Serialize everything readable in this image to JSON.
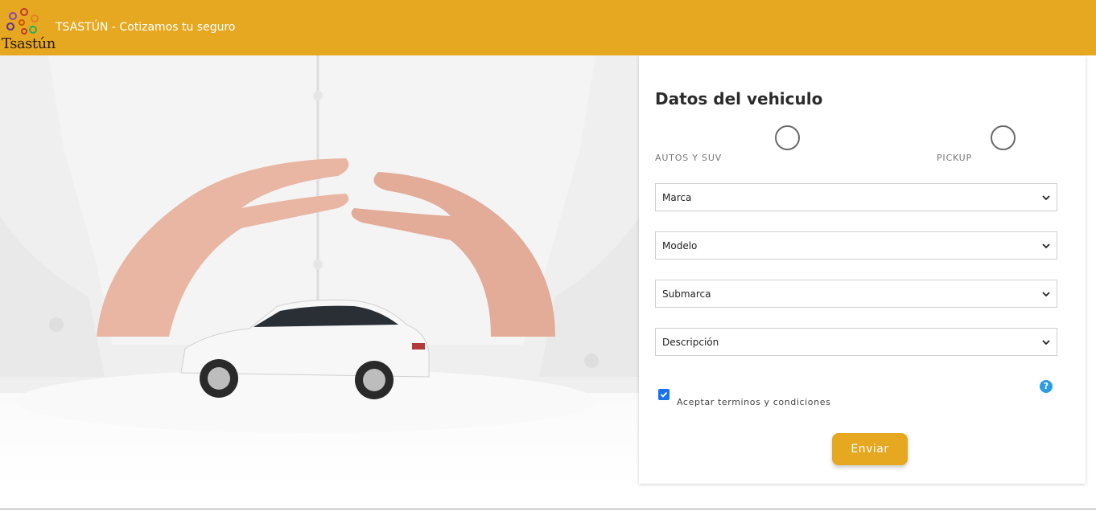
{
  "header": {
    "logo_text": "Tsastún",
    "brand": "TSASTÚN - Cotizamos tu seguro",
    "color": "#e5a820"
  },
  "form": {
    "title": "Datos del vehiculo",
    "vehicle_types": [
      {
        "label": "AUTOS Y SUV",
        "selected": false
      },
      {
        "label": "PICKUP",
        "selected": false
      }
    ],
    "selects": [
      {
        "value": "Marca"
      },
      {
        "value": "Modelo"
      },
      {
        "value": "Submarca"
      },
      {
        "value": "Descripción"
      }
    ],
    "terms_label": "Aceptar terminos y condiciones",
    "terms_checked": true,
    "help_glyph": "?",
    "submit_label": "Enviar"
  }
}
